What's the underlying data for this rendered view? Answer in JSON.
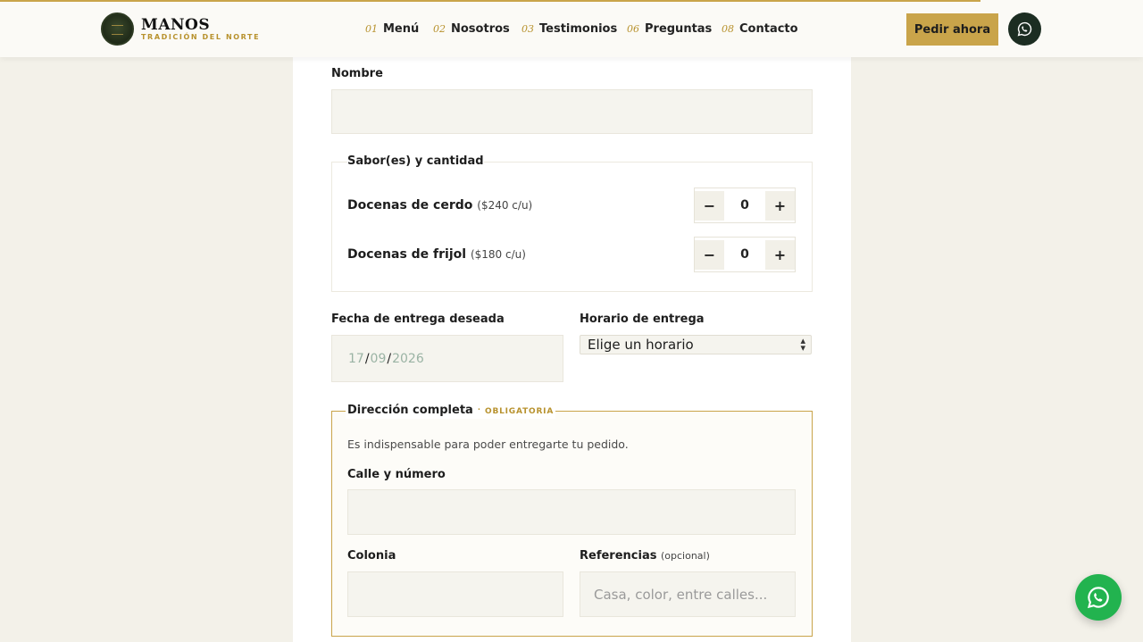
{
  "header": {
    "brand_name": "MANOS",
    "brand_tagline": "TRADICIÓN DEL NORTE",
    "nav": [
      {
        "num": "01",
        "label": "Menú"
      },
      {
        "num": "02",
        "label": "Nosotros"
      },
      {
        "num": "03",
        "label": "Testimonios"
      },
      {
        "num": "06",
        "label": "Preguntas"
      },
      {
        "num": "08",
        "label": "Contacto"
      }
    ],
    "order_label": "Pedir ahora",
    "whatsapp_icon": "whatsapp-icon"
  },
  "form": {
    "name_label": "Nombre",
    "name_value": "",
    "flavors": {
      "legend": "Sabor(es) y cantidad",
      "items": [
        {
          "label": "Docenas de cerdo",
          "price": "($240 c/u)",
          "qty": "0",
          "minus": "−",
          "plus": "+"
        },
        {
          "label": "Docenas de frijol",
          "price": "($180 c/u)",
          "qty": "0",
          "minus": "−",
          "plus": "+"
        }
      ]
    },
    "date": {
      "label": "Fecha de entrega deseada",
      "day": "17",
      "month": "09",
      "year": "2026",
      "sep": "/"
    },
    "schedule": {
      "label": "Horario de entrega",
      "selected": "Elige un horario"
    },
    "address": {
      "legend": "Dirección completa",
      "dot": "·",
      "required": "OBLIGATORIA",
      "helper": "Es indispensable para poder entregarte tu pedido.",
      "street_label": "Calle y número",
      "street_value": "",
      "colonia_label": "Colonia",
      "colonia_value": "",
      "refs_label": "Referencias",
      "refs_note": "(opcional)",
      "refs_placeholder": "Casa, color, entre calles..."
    }
  },
  "colors": {
    "accent": "#c9a44a",
    "dark": "#1c2d22",
    "whatsapp": "#22b34f",
    "background": "#f3f1e9"
  }
}
